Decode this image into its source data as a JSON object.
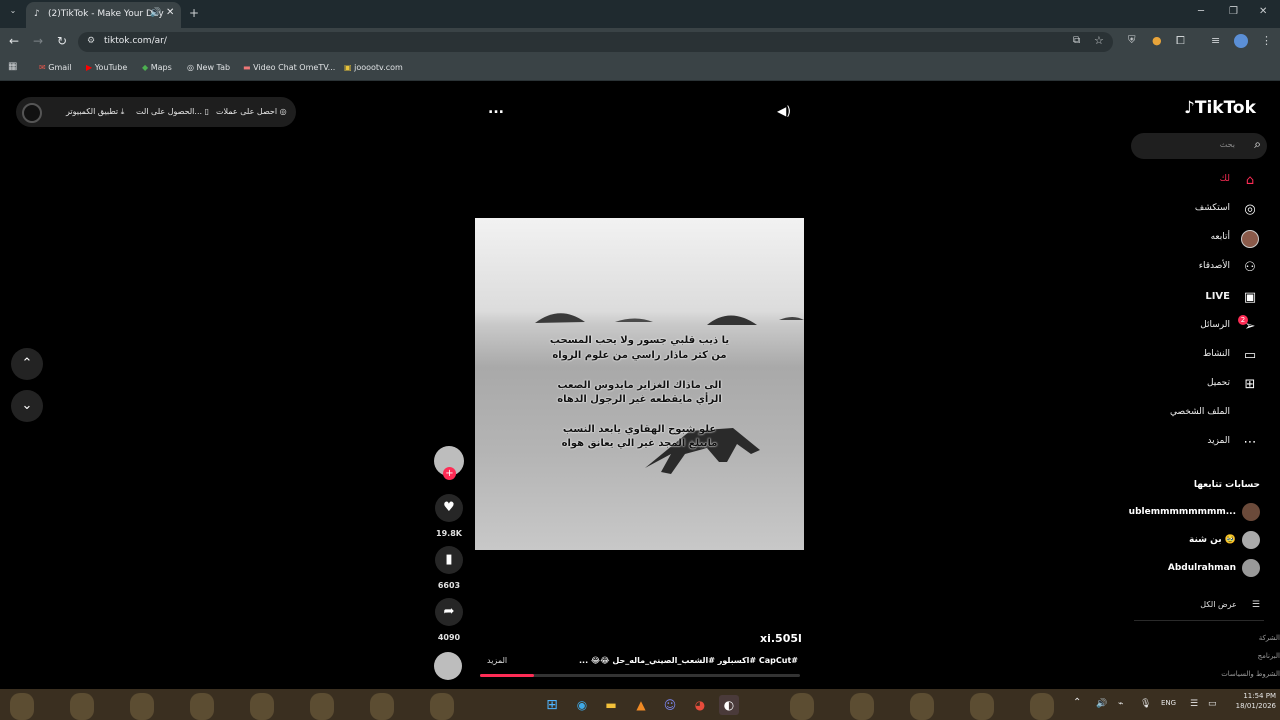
{
  "browser": {
    "tab_title": "(2)TikTok - Make Your Day",
    "new_tab_icon": "plus-icon",
    "url": "tiktok.com/ar/",
    "bookmarks": [
      "Gmail",
      "YouTube",
      "Maps",
      "New Tab",
      "Video Chat OmeTV...",
      "jooootv.com"
    ]
  },
  "tiktok": {
    "logo": "TikTok",
    "search_placeholder": "بحث",
    "top_pill": {
      "coins": "احصل على عملات",
      "get_app": "الحصول على الت...",
      "desktop_app": "تطبيق الكمبيوتر"
    },
    "more_dots": "...",
    "nav": [
      {
        "label": "لك",
        "icon": "home-icon"
      },
      {
        "label": "استكشف",
        "icon": "compass-icon"
      },
      {
        "label": "أتابعه",
        "icon": "avatar-icon"
      },
      {
        "label": "الأصدقاء",
        "icon": "friends-icon"
      },
      {
        "label": "LIVE",
        "icon": "live-icon"
      },
      {
        "label": "الرسائل",
        "icon": "send-icon",
        "badge": "2"
      },
      {
        "label": "النشاط",
        "icon": "activity-icon"
      },
      {
        "label": "تحميل",
        "icon": "upload-icon"
      },
      {
        "label": "الملف الشخصي",
        "icon": "profile-icon"
      },
      {
        "label": "المزيد",
        "icon": "more-icon"
      }
    ],
    "following_title": "حسابات تتابعها",
    "following": [
      {
        "name": "ublemmmmmmmm..."
      },
      {
        "name": "بن شنة 🥹"
      },
      {
        "name": "Abdulrahman"
      }
    ],
    "see_all": "عرض الكل",
    "footer_links": [
      "الشركة",
      "البرنامج",
      "الشروط والسياسات"
    ],
    "video": {
      "lyrics": [
        "يا ذيب قلبي جسور ولا يحب المسحب",
        "من كثر ماذار راسي من علوم الرواه",
        "الى ماذاك الغزاير مايدوس الصعب",
        "الرأي مايقطعه غير الرجول الدهاه",
        "علو شبوح الهقاوي يابعد النسب",
        "مايبلغ المجد غير الي يعانق هواه"
      ],
      "author": "xi.505l",
      "caption": "#CapCut #اكسبلور #الشعب_الصيني_ماله_حل 😂😂 ...",
      "more": "المزيد",
      "likes": "19.8K",
      "saves": "6603",
      "shares": "4090",
      "progress": 0.17
    }
  },
  "taskbar": {
    "lang": "ENG",
    "time": "11:54 PM",
    "date": "18/01/2026"
  },
  "colors": {
    "accent": "#fe2c55",
    "chrome_bg": "#3a4346"
  }
}
